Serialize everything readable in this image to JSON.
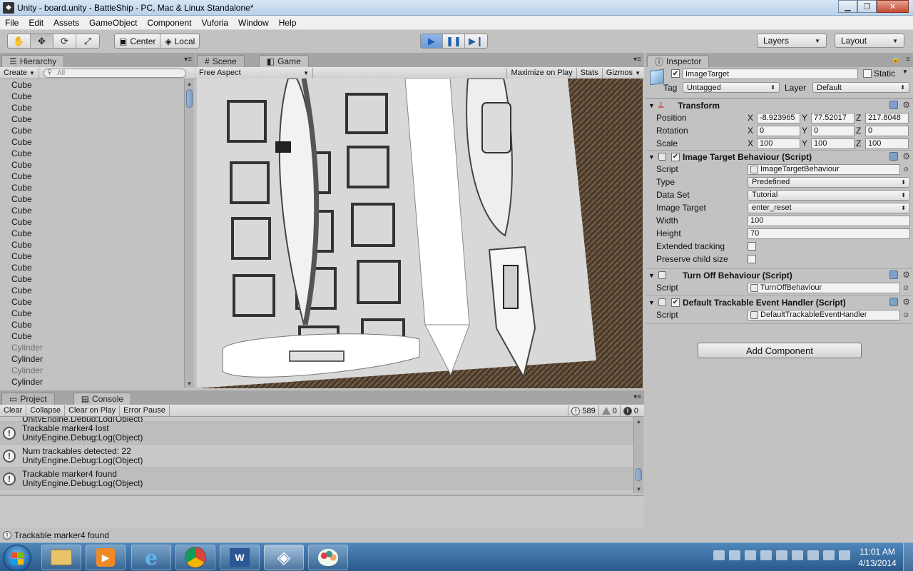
{
  "window": {
    "title": "Unity - board.unity - BattleShip - PC, Mac & Linux Standalone*"
  },
  "menu": [
    "File",
    "Edit",
    "Assets",
    "GameObject",
    "Component",
    "Vuforia",
    "Window",
    "Help"
  ],
  "toolbar": {
    "pivot_center": "Center",
    "pivot_local": "Local",
    "layers": "Layers",
    "layout": "Layout"
  },
  "hierarchy": {
    "tab": "Hierarchy",
    "create": "Create",
    "search_placeholder": "All",
    "items": [
      {
        "name": "Cube",
        "dim": false
      },
      {
        "name": "Cube",
        "dim": false
      },
      {
        "name": "Cube",
        "dim": false
      },
      {
        "name": "Cube",
        "dim": false
      },
      {
        "name": "Cube",
        "dim": false
      },
      {
        "name": "Cube",
        "dim": false
      },
      {
        "name": "Cube",
        "dim": false
      },
      {
        "name": "Cube",
        "dim": false
      },
      {
        "name": "Cube",
        "dim": false
      },
      {
        "name": "Cube",
        "dim": false
      },
      {
        "name": "Cube",
        "dim": false
      },
      {
        "name": "Cube",
        "dim": false
      },
      {
        "name": "Cube",
        "dim": false
      },
      {
        "name": "Cube",
        "dim": false
      },
      {
        "name": "Cube",
        "dim": false
      },
      {
        "name": "Cube",
        "dim": false
      },
      {
        "name": "Cube",
        "dim": false
      },
      {
        "name": "Cube",
        "dim": false
      },
      {
        "name": "Cube",
        "dim": false
      },
      {
        "name": "Cube",
        "dim": false
      },
      {
        "name": "Cube",
        "dim": false
      },
      {
        "name": "Cube",
        "dim": false
      },
      {
        "name": "Cube",
        "dim": false
      },
      {
        "name": "Cylinder",
        "dim": true
      },
      {
        "name": "Cylinder",
        "dim": false
      },
      {
        "name": "Cylinder",
        "dim": true
      },
      {
        "name": "Cylinder",
        "dim": false
      }
    ]
  },
  "game": {
    "tab_scene": "Scene",
    "tab_game": "Game",
    "aspect": "Free Aspect",
    "maximize": "Maximize on Play",
    "stats": "Stats",
    "gizmos": "Gizmos"
  },
  "console": {
    "tab_project": "Project",
    "tab_console": "Console",
    "buttons": [
      "Clear",
      "Collapse",
      "Clear on Play",
      "Error Pause"
    ],
    "count_logs": "589",
    "count_warnings": "0",
    "count_errors": "0",
    "partial_line": "UnityEngine.Debug:Log(Object)",
    "entries": [
      {
        "line1": "Trackable marker4 lost",
        "line2": "UnityEngine.Debug:Log(Object)"
      },
      {
        "line1": "Num trackables detected: 22",
        "line2": "UnityEngine.Debug:Log(Object)"
      },
      {
        "line1": "Trackable marker4 found",
        "line2": "UnityEngine.Debug:Log(Object)"
      }
    ]
  },
  "inspector": {
    "tab": "Inspector",
    "object_name": "ImageTarget",
    "static_label": "Static",
    "tag_label": "Tag",
    "tag_value": "Untagged",
    "layer_label": "Layer",
    "layer_value": "Default",
    "transform": {
      "title": "Transform",
      "position_label": "Position",
      "rotation_label": "Rotation",
      "scale_label": "Scale",
      "pos": [
        "-8.923965",
        "77.52017",
        "217.8048"
      ],
      "rot": [
        "0",
        "0",
        "0"
      ],
      "scale": [
        "100",
        "100",
        "100"
      ]
    },
    "itb": {
      "title": "Image Target Behaviour (Script)",
      "script_label": "Script",
      "script": "ImageTargetBehaviour",
      "type_label": "Type",
      "type": "Predefined",
      "dataset_label": "Data Set",
      "dataset": "Tutorial",
      "target_label": "Image Target",
      "target": "enter_reset",
      "width_label": "Width",
      "width": "100",
      "height_label": "Height",
      "height": "70",
      "extended_label": "Extended tracking",
      "preserve_label": "Preserve child size"
    },
    "tob": {
      "title": "Turn Off Behaviour (Script)",
      "script_label": "Script",
      "script": "TurnOffBehaviour"
    },
    "dteh": {
      "title": "Default Trackable Event Handler (Script)",
      "script_label": "Script",
      "script": "DefaultTrackableEventHandler"
    },
    "add_component": "Add Component"
  },
  "status": "Trackable marker4 found",
  "clock": {
    "time": "11:01 AM",
    "date": "4/13/2014"
  }
}
